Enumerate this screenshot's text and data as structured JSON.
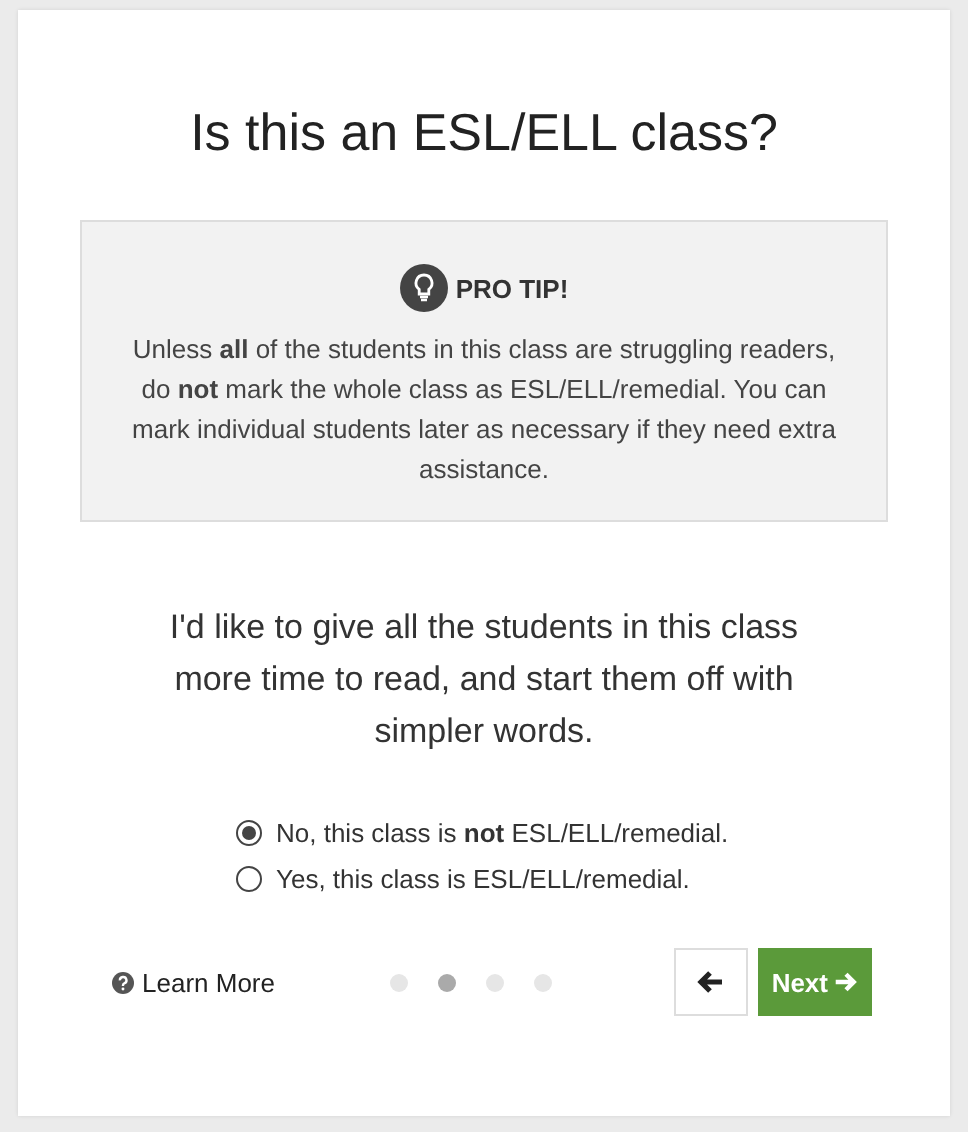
{
  "title": "Is this an ESL/ELL class?",
  "tip": {
    "heading": "PRO TIP!",
    "text": "Unless **all** of the students in this class are struggling readers, do **not** mark the whole class as ESL/ELL/remedial. You can mark individual students later as necessary if they need extra assistance."
  },
  "question": "I'd like to give all the students in this class more time to read, and start them off with simpler words.",
  "options": [
    {
      "label": "No, this class is **not** ESL/ELL/remedial.",
      "selected": true
    },
    {
      "label": "Yes, this class is ESL/ELL/remedial.",
      "selected": false
    }
  ],
  "learn_more": "Learn More",
  "steps": [
    {
      "selected": false
    },
    {
      "selected": true
    },
    {
      "selected": false
    },
    {
      "selected": false
    }
  ],
  "next": "Next"
}
